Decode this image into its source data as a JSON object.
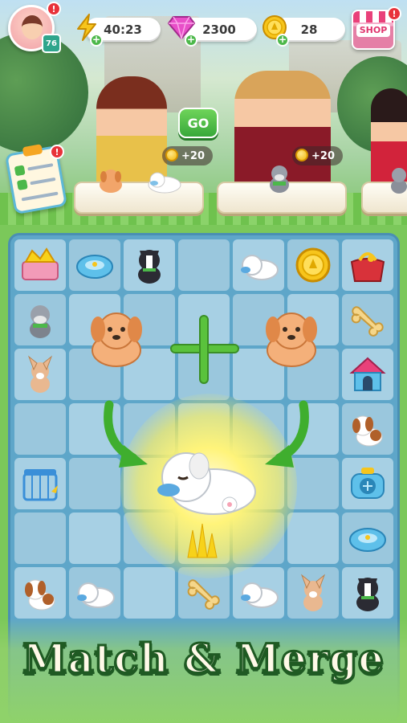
{
  "hud": {
    "player_level": "76",
    "energy": "40:23",
    "gems": "2300",
    "coins": "28",
    "shop_label": "SHOP"
  },
  "go_label": "GO",
  "customers": [
    {
      "reward": "+20"
    },
    {
      "reward": "+20"
    }
  ],
  "banner": {
    "title": "Match & Merge"
  },
  "board_items": [
    "cheese-crate",
    "pet-bowl",
    "boston-terrier",
    "empty",
    "sleeping-puppy",
    "coin",
    "red-purse",
    "schnauzer",
    "empty",
    "empty",
    "empty",
    "empty",
    "empty",
    "bone",
    "chihuahua",
    "empty",
    "empty",
    "empty",
    "empty",
    "empty",
    "dog-house",
    "empty",
    "empty",
    "empty",
    "empty",
    "empty",
    "empty",
    "beagle",
    "pet-cage",
    "empty",
    "empty",
    "empty",
    "empty",
    "empty",
    "pet-carrier",
    "empty",
    "empty",
    "empty",
    "empty",
    "empty",
    "empty",
    "pet-bowl",
    "beagle",
    "sleeping-puppy",
    "empty",
    "bone",
    "sleeping-puppy",
    "chihuahua",
    "boston-terrier"
  ],
  "colors": {
    "board": "#5ea6c9",
    "cell": "#a7d0e4",
    "accent_green": "#5ac23c",
    "title_stroke": "#1f5a23"
  }
}
